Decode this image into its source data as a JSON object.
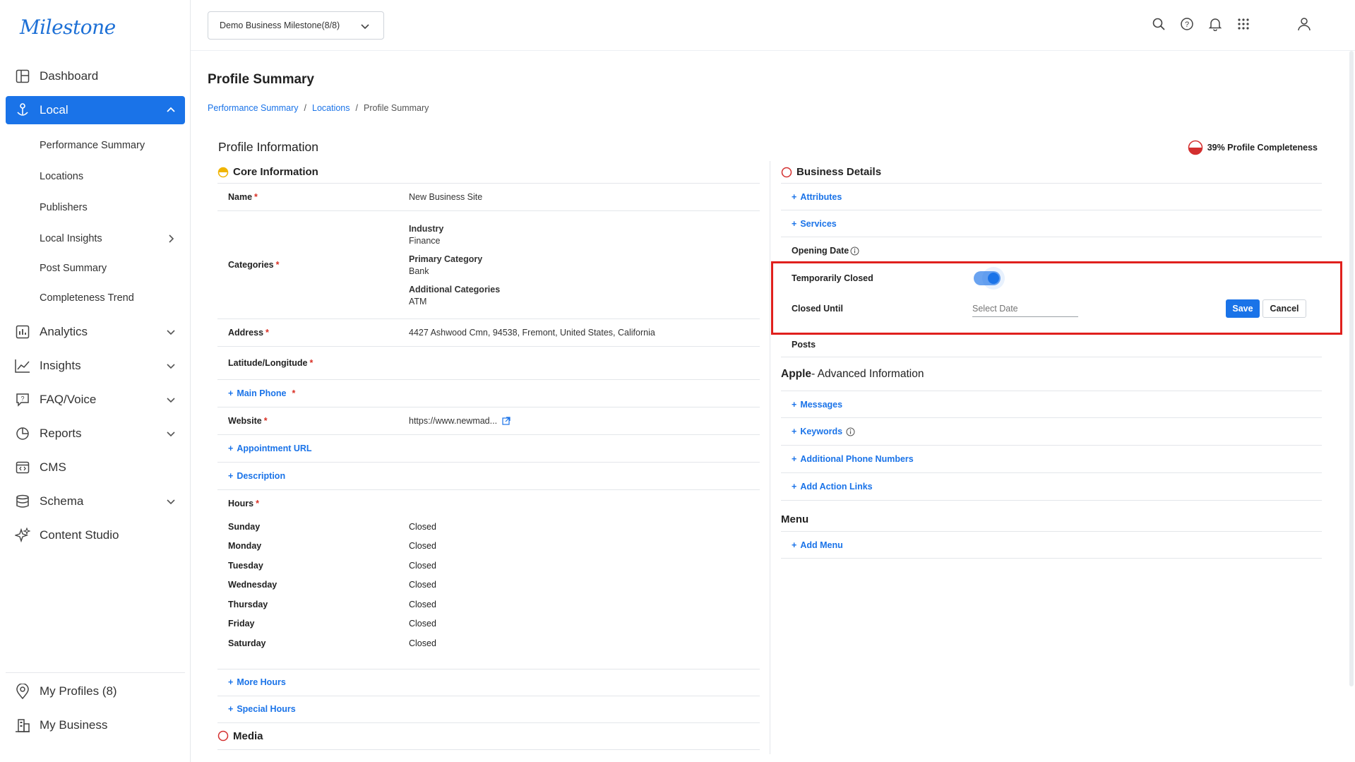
{
  "brand": {
    "logo": "Milestone",
    "accent": "#1a73e8"
  },
  "sidebar": {
    "items": [
      {
        "label": "Dashboard",
        "icon": "dashboard-icon"
      },
      {
        "label": "Local",
        "icon": "local-icon",
        "active": true
      },
      {
        "label": "Analytics",
        "icon": "analytics-icon"
      },
      {
        "label": "Insights",
        "icon": "insights-icon"
      },
      {
        "label": "FAQ/Voice",
        "icon": "faq-icon"
      },
      {
        "label": "Reports",
        "icon": "reports-icon"
      },
      {
        "label": "CMS",
        "icon": "cms-icon"
      },
      {
        "label": "Schema",
        "icon": "schema-icon"
      },
      {
        "label": "Content Studio",
        "icon": "sparkle-icon"
      }
    ],
    "local_sub": [
      "Performance Summary",
      "Locations",
      "Publishers",
      "Local Insights",
      "Post Summary",
      "Completeness Trend"
    ],
    "bottom": [
      {
        "label": "My Profiles (8)",
        "icon": "location-pin-icon"
      },
      {
        "label": "My Business",
        "icon": "business-icon"
      }
    ]
  },
  "topbar": {
    "business_select": "Demo Business Milestone(8/8)"
  },
  "page": {
    "title": "Profile Summary",
    "breadcrumb": [
      "Performance Summary",
      "Locations",
      "Profile Summary"
    ]
  },
  "profile": {
    "card_title": "Profile Information",
    "completeness": "39% Profile Completeness",
    "core": {
      "title": "Core Information",
      "name_label": "Name",
      "name_value": "New Business Site",
      "categories_label": "Categories",
      "industry_k": "Industry",
      "industry_v": "Finance",
      "primary_k": "Primary Category",
      "primary_v": "Bank",
      "additional_k": "Additional Categories",
      "additional_v": "ATM",
      "address_label": "Address",
      "address_value": "4427 Ashwood Cmn, 94538, Fremont, United States, California",
      "latlng_label": "Latitude/Longitude",
      "main_phone": "Main Phone",
      "website_label": "Website",
      "website_value": "https://www.newmad...",
      "appointment": "Appointment URL",
      "description": "Description",
      "hours_label": "Hours",
      "hours": [
        {
          "day": "Sunday",
          "status": "Closed"
        },
        {
          "day": "Monday",
          "status": "Closed"
        },
        {
          "day": "Tuesday",
          "status": "Closed"
        },
        {
          "day": "Wednesday",
          "status": "Closed"
        },
        {
          "day": "Thursday",
          "status": "Closed"
        },
        {
          "day": "Friday",
          "status": "Closed"
        },
        {
          "day": "Saturday",
          "status": "Closed"
        }
      ],
      "more_hours": "More Hours",
      "special_hours": "Special Hours",
      "media": "Media"
    },
    "business": {
      "title": "Business Details",
      "attributes": "Attributes",
      "services": "Services",
      "opening_date": "Opening Date",
      "temporarily_closed": "Temporarily Closed",
      "closed_until": "Closed Until",
      "date_placeholder": "Select Date",
      "save": "Save",
      "cancel": "Cancel",
      "posts": "Posts"
    },
    "apple": {
      "title_bold": "Apple",
      "title_rest": " - Advanced Information",
      "messages": "Messages",
      "keywords": "Keywords",
      "phones": "Additional Phone Numbers",
      "action_links": "Add Action Links"
    },
    "menu": {
      "title": "Menu",
      "add": "Add Menu"
    }
  }
}
